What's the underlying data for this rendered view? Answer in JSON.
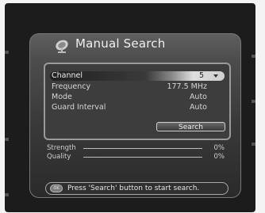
{
  "window": {
    "title": "Manual Search"
  },
  "form": {
    "channel_label": "Channel",
    "channel_value": "5",
    "frequency_label": "Frequency",
    "frequency_value": "177.5 MHz",
    "mode_label": "Mode",
    "mode_value": "Auto",
    "guard_label": "Guard Interval",
    "guard_value": "Auto",
    "search_button_label": "Search"
  },
  "meters": {
    "strength_label": "Strength",
    "strength_value": "0%",
    "strength_level": 0,
    "quality_label": "Quality",
    "quality_value": "0%",
    "quality_level": 0
  },
  "status": {
    "ok_icon_text": "OK",
    "text": "Press 'Search' button to start search."
  },
  "icons": {
    "header_icon": "satellite-dish-icon",
    "ok_button_icon": "ok-button-icon",
    "dropdown_icon": "chevron-down-icon"
  }
}
